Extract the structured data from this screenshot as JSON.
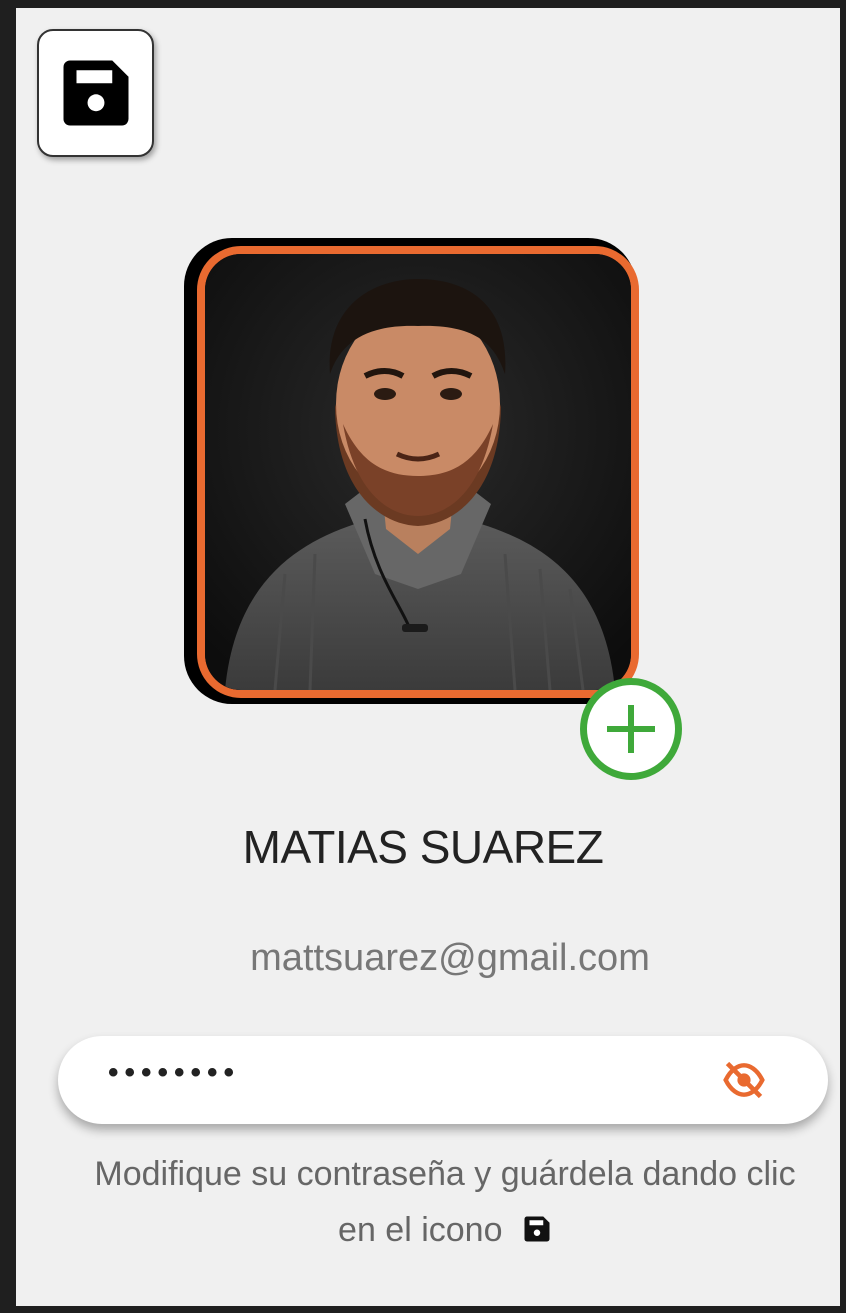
{
  "profile": {
    "name": "MATIAS SUAREZ",
    "email": "mattsuarez@gmail.com"
  },
  "password": {
    "value": "••••••••"
  },
  "hint": {
    "line1": "Modifique su contraseña y guárdela dando clic",
    "line2": "en el icono"
  },
  "icons": {
    "save": "save-icon",
    "add": "plus-circle-icon",
    "visibility": "eye-off-icon"
  },
  "colors": {
    "accent_orange": "#e96a30",
    "add_green": "#3fa93a",
    "panel_bg": "#f0f0f0"
  }
}
